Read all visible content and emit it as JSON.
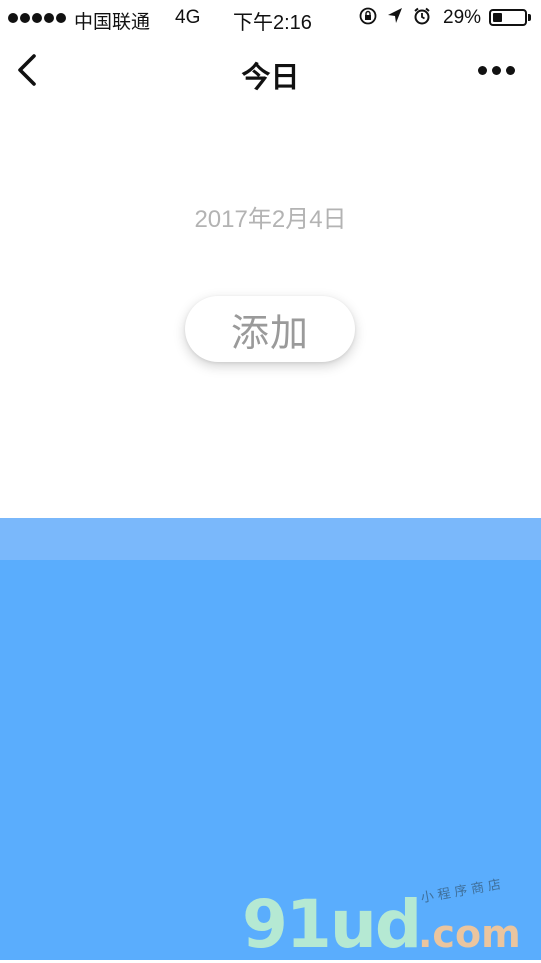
{
  "status_bar": {
    "carrier": "中国联通",
    "network": "4G",
    "time": "下午2:16",
    "battery_percent": "29%",
    "battery_level": 0.29,
    "icons": [
      "rotation-lock-icon",
      "location-arrow-icon",
      "alarm-icon"
    ]
  },
  "nav": {
    "title": "今日",
    "back_icon": "chevron-left-icon",
    "more_icon": "more-dots-icon"
  },
  "main": {
    "date": "2017年2月4日",
    "add_label": "添加"
  },
  "colors": {
    "water_band": "#7ab8fb",
    "water_main": "#5aadfd",
    "date_text": "#b3b3b3",
    "button_text": "#9a9a9a"
  },
  "watermark": {
    "brand": "91ud",
    "domain": ".com",
    "tagline": "小程序商店"
  }
}
